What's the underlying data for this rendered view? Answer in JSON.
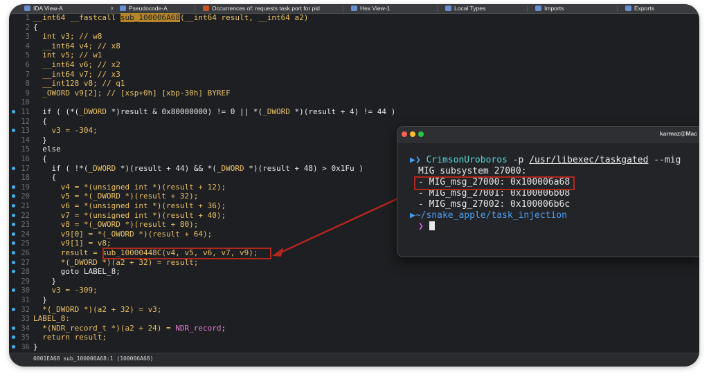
{
  "tabs": [
    {
      "label": "IDA View-A",
      "color": "#6a8fd0",
      "close": "×"
    },
    {
      "label": "Pseudocode-A",
      "color": "#6a8fd0"
    },
    {
      "label": "Occurrences of: requests task port for pid",
      "color": "#c8552a"
    },
    {
      "label": "Hex View-1",
      "color": "#6a8fd0"
    },
    {
      "label": "Local Types",
      "color": "#6a8fd0"
    },
    {
      "label": "Imports",
      "color": "#6a8fd0"
    },
    {
      "label": "Exports",
      "color": "#6a8fd0"
    }
  ],
  "lines": [
    {
      "n": "1",
      "dot": false,
      "segs": [
        [
          "ty",
          "__int64 __fastcall "
        ],
        [
          "hl",
          "sub_100006A68"
        ],
        [
          "ty",
          "(__int64 result, __int64 a2)"
        ]
      ]
    },
    {
      "n": "2",
      "dot": false,
      "segs": [
        [
          "nm",
          "{"
        ]
      ]
    },
    {
      "n": "3",
      "dot": false,
      "segs": [
        [
          "ty",
          "  int v3; // w8"
        ]
      ]
    },
    {
      "n": "4",
      "dot": false,
      "segs": [
        [
          "ty",
          "  __int64 v4; // x8"
        ]
      ]
    },
    {
      "n": "5",
      "dot": false,
      "segs": [
        [
          "ty",
          "  int v5; // w1"
        ]
      ]
    },
    {
      "n": "6",
      "dot": false,
      "segs": [
        [
          "ty",
          "  __int64 v6; // x2"
        ]
      ]
    },
    {
      "n": "7",
      "dot": false,
      "segs": [
        [
          "ty",
          "  __int64 v7; // x3"
        ]
      ]
    },
    {
      "n": "8",
      "dot": false,
      "segs": [
        [
          "ty",
          "  __int128 v8; // q1"
        ]
      ]
    },
    {
      "n": "9",
      "dot": false,
      "segs": [
        [
          "ty",
          "  _OWORD v9[2]; // [xsp+0h] [xbp-30h] BYREF"
        ]
      ]
    },
    {
      "n": "10",
      "dot": false,
      "segs": [
        [
          "nm",
          ""
        ]
      ]
    },
    {
      "n": "11",
      "dot": true,
      "segs": [
        [
          "nm",
          "  if ( (*("
        ],
        [
          "ty",
          "_DWORD"
        ],
        [
          "nm",
          " *)result & 0x80000000) != 0 || *("
        ],
        [
          "ty",
          "_DWORD"
        ],
        [
          "nm",
          " *)(result + 4) != 44 )"
        ]
      ]
    },
    {
      "n": "12",
      "dot": false,
      "segs": [
        [
          "nm",
          "  {"
        ]
      ]
    },
    {
      "n": "13",
      "dot": true,
      "segs": [
        [
          "ty",
          "    v3 = -304;"
        ]
      ]
    },
    {
      "n": "14",
      "dot": false,
      "segs": [
        [
          "nm",
          "  }"
        ]
      ]
    },
    {
      "n": "15",
      "dot": false,
      "segs": [
        [
          "nm",
          "  else"
        ]
      ]
    },
    {
      "n": "16",
      "dot": false,
      "segs": [
        [
          "nm",
          "  {"
        ]
      ]
    },
    {
      "n": "17",
      "dot": true,
      "segs": [
        [
          "nm",
          "    if ( !*("
        ],
        [
          "ty",
          "_DWORD"
        ],
        [
          "nm",
          " *)(result + 44) && *("
        ],
        [
          "ty",
          "_DWORD"
        ],
        [
          "nm",
          " *)(result + 48) > 0x1Fu )"
        ]
      ]
    },
    {
      "n": "18",
      "dot": false,
      "segs": [
        [
          "nm",
          "    {"
        ]
      ]
    },
    {
      "n": "19",
      "dot": true,
      "segs": [
        [
          "ty",
          "      v4 = *(unsigned int *)(result + 12);"
        ]
      ]
    },
    {
      "n": "20",
      "dot": true,
      "segs": [
        [
          "ty",
          "      v5 = *(_DWORD *)(result + 32);"
        ]
      ]
    },
    {
      "n": "21",
      "dot": true,
      "segs": [
        [
          "ty",
          "      v6 = *(unsigned int *)(result + 36);"
        ]
      ]
    },
    {
      "n": "22",
      "dot": true,
      "segs": [
        [
          "ty",
          "      v7 = *(unsigned int *)(result + 40);"
        ]
      ]
    },
    {
      "n": "23",
      "dot": true,
      "segs": [
        [
          "ty",
          "      v8 = *(_OWORD *)(result + 80);"
        ]
      ]
    },
    {
      "n": "24",
      "dot": true,
      "segs": [
        [
          "ty",
          "      v9[0] = *(_OWORD *)(result + 64);"
        ]
      ]
    },
    {
      "n": "25",
      "dot": true,
      "segs": [
        [
          "ty",
          "      v9[1] = v8;"
        ]
      ]
    },
    {
      "n": "26",
      "dot": true,
      "segs": [
        [
          "ty",
          "      result = sub_10000448C(v4, v5, v6, v7, v9);"
        ]
      ]
    },
    {
      "n": "27",
      "dot": true,
      "segs": [
        [
          "ty",
          "      *(_DWORD *)(a2 + 32) = result;"
        ]
      ]
    },
    {
      "n": "28",
      "dot": true,
      "segs": [
        [
          "nm",
          "      goto LABEL_8;"
        ]
      ]
    },
    {
      "n": "29",
      "dot": false,
      "segs": [
        [
          "nm",
          "    }"
        ]
      ]
    },
    {
      "n": "30",
      "dot": true,
      "segs": [
        [
          "ty",
          "    v3 = -309;"
        ]
      ]
    },
    {
      "n": "31",
      "dot": false,
      "segs": [
        [
          "nm",
          "  }"
        ]
      ]
    },
    {
      "n": "32",
      "dot": true,
      "segs": [
        [
          "ty",
          "  *(_DWORD *)(a2 + 32) = v3;"
        ]
      ]
    },
    {
      "n": "33",
      "dot": false,
      "segs": [
        [
          "ty",
          "LABEL_8:"
        ]
      ]
    },
    {
      "n": "34",
      "dot": true,
      "segs": [
        [
          "ty",
          "  *(NDR_record_t *)(a2 + 24) = "
        ],
        [
          "mac",
          "NDR_record"
        ],
        [
          "ty",
          ";"
        ]
      ]
    },
    {
      "n": "35",
      "dot": true,
      "segs": [
        [
          "ty",
          "  return result;"
        ]
      ]
    },
    {
      "n": "36",
      "dot": true,
      "segs": [
        [
          "nm",
          "}"
        ]
      ]
    }
  ],
  "status": "0001EA68 sub_100006A68:1 (100006A68)",
  "terminal": {
    "title": "karmaz@Mac",
    "prompt_glyph": "▶❯",
    "command": "CrimsonUroboros",
    "args_pre": "-p ",
    "path": "/usr/libexec/taskgated",
    "args_post": " --mig",
    "output": [
      "MIG subsystem 27000:",
      "- MIG_msg_27000: 0x100006a68",
      "- MIG_msg_27001: 0x100006b08",
      "- MIG_msg_27002: 0x100006b6c"
    ],
    "cwd": "~/snake_apple/task_injection",
    "cwd_glyph": "▶",
    "prompt2": "❯"
  }
}
